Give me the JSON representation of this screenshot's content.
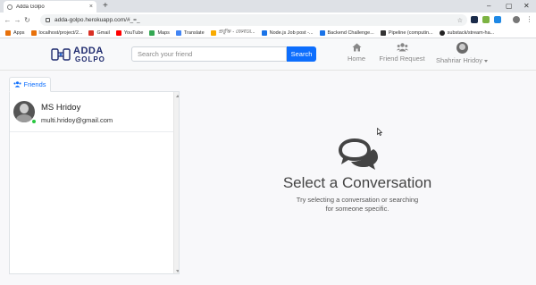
{
  "browser": {
    "tab_title": "Adda Golpo",
    "tab_close": "×",
    "new_tab": "+",
    "window_controls": [
      "–",
      "▢",
      "✕"
    ],
    "url": "adda-golpo.herokuapp.com/#_=_",
    "bookmarks": [
      {
        "label": "Apps",
        "color": "#e8710a"
      },
      {
        "label": "localhost/project/2...",
        "color": "#e8710a"
      },
      {
        "label": "Gmail",
        "color": "#d93025"
      },
      {
        "label": "YouTube",
        "color": "#ff0000"
      },
      {
        "label": "Maps",
        "color": "#34a853"
      },
      {
        "label": "Translate",
        "color": "#4285f4"
      },
      {
        "label": "প্রযুক্তি - জেনারে...",
        "color": "#f9ab00"
      },
      {
        "label": "Node.js Job post -...",
        "color": "#1a73e8"
      },
      {
        "label": "Backend Challenge...",
        "color": "#1a73e8"
      },
      {
        "label": "Pipeline (computin...",
        "color": "#333333"
      },
      {
        "label": "substack/stream-ha...",
        "color": "#222222"
      }
    ]
  },
  "navbar": {
    "logo_line1": "ADDA",
    "logo_line2": "GOLPO",
    "search_placeholder": "Search your friend",
    "search_button": "Search",
    "home_label": "Home",
    "friend_request_label": "Friend Request",
    "profile_name": "Shahriar Hridoy"
  },
  "sidebar": {
    "tab_label": "Friends",
    "friends": [
      {
        "name": "MS Hridoy",
        "email": "multi.hridoy@gmail.com",
        "online": true
      }
    ]
  },
  "main": {
    "title": "Select a Conversation",
    "subtitle_line1": "Try selecting a conversation or searching",
    "subtitle_line2": "for someone specific."
  },
  "colors": {
    "primary": "#0d6efd",
    "online": "#28c840",
    "logo": "#1e2a6e"
  }
}
